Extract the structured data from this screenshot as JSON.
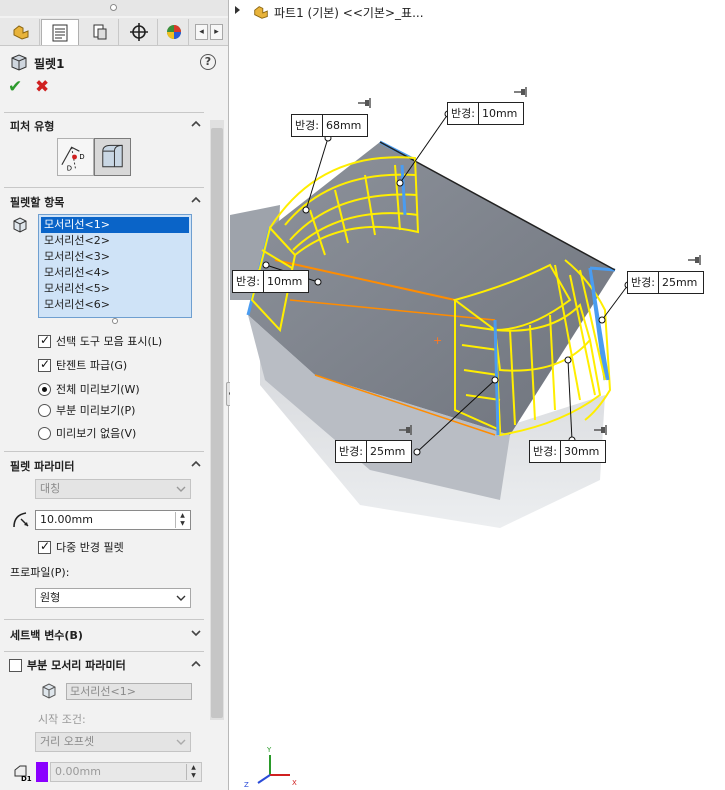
{
  "tabs": [
    {
      "icon": "feature-manager-icon"
    },
    {
      "icon": "property-manager-icon"
    },
    {
      "icon": "configuration-manager-icon"
    },
    {
      "icon": "dimxpert-icon"
    },
    {
      "icon": "display-manager-icon"
    }
  ],
  "feature": {
    "title": "필렛1",
    "icon": "fillet-icon"
  },
  "sections": {
    "fillet_type": "피처 유형",
    "items_to_fillet": "필렛할 항목",
    "fillet_parameters": "필렛 파라미터",
    "setback": "세트백 변수(B)",
    "partial_edge": "부분 모서리 파라미터"
  },
  "edges": [
    "모서리선<1>",
    "모서리선<2>",
    "모서리선<3>",
    "모서리선<4>",
    "모서리선<5>",
    "모서리선<6>"
  ],
  "options": {
    "show_toolbar": "선택 도구 모음 표시(L)",
    "tangent_propagation": "탄젠트 파급(G)",
    "full_preview": "전체 미리보기(W)",
    "partial_preview": "부분 미리보기(P)",
    "no_preview": "미리보기 없음(V)"
  },
  "params": {
    "method": "대칭",
    "radius": "10.00mm",
    "multi_radius": "다중 반경 필렛",
    "profile_label": "프로파일(P):",
    "profile": "원형"
  },
  "partial": {
    "edge_field": "모서리선<1>",
    "start_condition_label": "시작 조건:",
    "offset_combo": "거리 오프셋",
    "distance": "0.00mm",
    "distance_color": "#8a00ff"
  },
  "tree": {
    "part_name": "파트1 (기본) <<기본>_표..."
  },
  "callouts": [
    {
      "label": "반경:",
      "value": "68mm"
    },
    {
      "label": "반경:",
      "value": "10mm"
    },
    {
      "label": "반경:",
      "value": "10mm"
    },
    {
      "label": "반경:",
      "value": "25mm"
    },
    {
      "label": "반경:",
      "value": "25mm"
    },
    {
      "label": "반경:",
      "value": "30mm"
    }
  ],
  "colors": {
    "accent_selected": "#0a64c8",
    "preview_fillet": "#ffee00",
    "edge_highlight": "#4a9cf0",
    "selection_edge": "#ff8c00"
  }
}
